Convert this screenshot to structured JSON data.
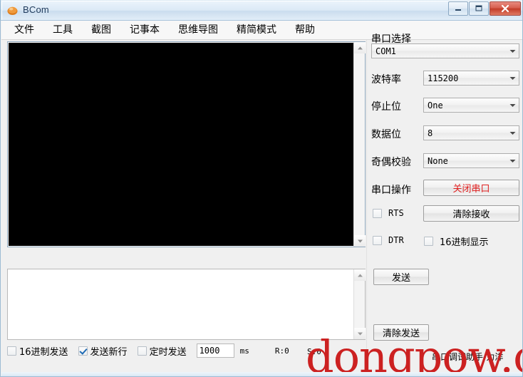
{
  "window": {
    "title": "BCom",
    "icon": "app-icon",
    "buttons": {
      "minimize": "minimize-icon",
      "maximize": "maximize-icon",
      "close": "close-icon"
    }
  },
  "menubar": {
    "items": [
      {
        "label": "文件"
      },
      {
        "label": "工具"
      },
      {
        "label": "截图"
      },
      {
        "label": "记事本"
      },
      {
        "label": "思维导图"
      },
      {
        "label": "精简模式"
      },
      {
        "label": "帮助"
      }
    ]
  },
  "receive_area": {
    "name": "receive-text-area",
    "content": "",
    "background_color": "#000000"
  },
  "send_area": {
    "name": "send-text-area",
    "content": "",
    "background_color": "#ffffff"
  },
  "bottom_options": {
    "hex_send": {
      "label": "16进制发送",
      "checked": false
    },
    "send_newline": {
      "label": "发送新行",
      "checked": true
    },
    "timed_send": {
      "label": "定时发送",
      "checked": false
    },
    "interval_value": "1000",
    "interval_unit": "ms",
    "rx_counter": "R:0",
    "tx_counter": "S:0"
  },
  "right_panel": {
    "port_select_label": "串口选择",
    "port_value": "COM1",
    "baud_label": "波特率",
    "baud_value": "115200",
    "stopbits_label": "停止位",
    "stopbits_value": "One",
    "databits_label": "数据位",
    "databits_value": "8",
    "parity_label": "奇偶校验",
    "parity_value": "None",
    "port_op_label": "串口操作",
    "close_port_button": "关闭串口",
    "clear_recv_button": "清除接收",
    "rts": {
      "label": "RTS",
      "checked": false
    },
    "dtr": {
      "label": "DTR",
      "checked": false
    },
    "hex_display": {
      "label": "16进制显示",
      "checked": false
    },
    "send_button": "发送",
    "clear_send_button": "清除发送"
  },
  "status": {
    "text": "串口调试助手-力洋"
  },
  "watermark": {
    "text": "dongpow.com",
    "color": "#cc2121"
  },
  "colors": {
    "danger": "#e02020",
    "titlebar_accent": "#1e395b"
  }
}
